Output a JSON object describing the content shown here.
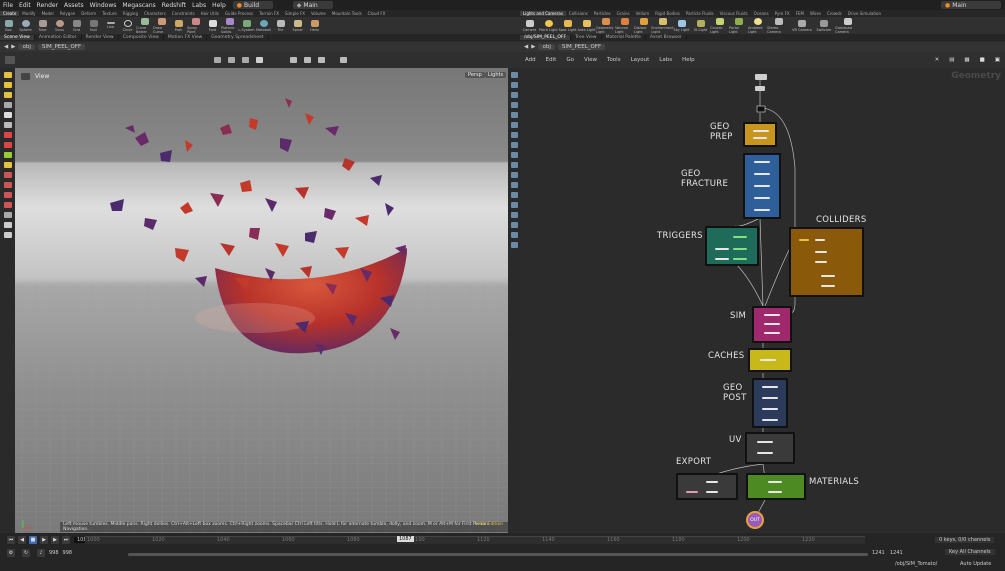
{
  "menu": [
    "File",
    "Edit",
    "Render",
    "Assets",
    "Windows",
    "Megascans",
    "Redshift",
    "Labs",
    "Help"
  ],
  "desktop": "Build",
  "take": "Main",
  "network_dropdown": "Main",
  "shelf_tabs": [
    "Create",
    "Modify",
    "Model",
    "Polygon",
    "Deform",
    "Texture",
    "Rigging",
    "Characters",
    "Constraints",
    "Hair Utils",
    "Guide Process",
    "Terrain FX",
    "Simple FX",
    "Volume",
    "Mountain Tools",
    "Cloud FX",
    "Lights and Cameras",
    "Collisions",
    "Particles",
    "Grains",
    "Vellum",
    "Rigid Bodies",
    "Particle Fluids",
    "Viscous Fluids",
    "Oceans",
    "Pyro FX",
    "FEM",
    "Wires",
    "Crowds",
    "Drive Simulation"
  ],
  "tools_left": [
    "Box",
    "Sphere",
    "Tube",
    "Torus",
    "Grid",
    "Null",
    "Line",
    "Circle",
    "Curve Bezier",
    "Draw Curve",
    "Path",
    "Spray Paint",
    "Font",
    "Platonic Solids",
    "L-System",
    "Metaball",
    "File",
    "Spiral",
    "Helix"
  ],
  "tools_right": [
    "Camera",
    "Point Light",
    "Spot Light",
    "Area Light",
    "Geometry Light",
    "Volume Light",
    "Distant Light",
    "Environment Light",
    "Sky Light",
    "GI Light",
    "Caustic Light",
    "Portal Light",
    "Ambient Light",
    "Stereo Camera",
    "VR Camera",
    "Switcher",
    "Gamepad Camera"
  ],
  "pane_tabs_left": [
    "Scene View",
    "Animation Editor",
    "Render View",
    "Composite View",
    "Motion FX View",
    "Geometry Spreadsheet"
  ],
  "pane_tabs_right": [
    "/obj/SIM_PEEL_OFF",
    "Tree View",
    "Material Palette",
    "Asset Browser"
  ],
  "path_left": {
    "ctx": "obj",
    "node": "SIM_PEEL_OFF"
  },
  "path_right": {
    "ctx": "obj",
    "node": "SIM_PEEL_OFF"
  },
  "viewport": {
    "label": "View",
    "persp": "Persp",
    "cam": "Lights",
    "help_text": "Left mouse tumbles. Middle pans. Right dollies. Ctrl+Alt+Left box zooms. Ctrl+Right zooms. Spacebar Ctrl Left tilts. Hold L for alternate tumble, dolly, and zoom. M or Alt+M for First Person Navigation.",
    "edition": "Indie Edition"
  },
  "net_menu": [
    "Add",
    "Edit",
    "Go",
    "View",
    "Tools",
    "Layout",
    "Labs",
    "Help"
  ],
  "net_context": "Geometry",
  "net_labels": {
    "geo_prep": "GEO\nPREP",
    "geo_fracture": "GEO\nFRACTURE",
    "triggers": "TRIGGERS",
    "colliders": "COLLIDERS",
    "sim": "SIM",
    "caches": "CACHES",
    "geo_post": "GEO\nPOST",
    "uv": "UV",
    "export": "EXPORT",
    "materials": "MATERIALS",
    "out_node": "OUT"
  },
  "colors": {
    "geo_prep": "#c8961e",
    "geo_fracture": "#2f5f9a",
    "triggers": "#1f6b5a",
    "colliders": "#8a5a0a",
    "sim": "#a0296e",
    "caches": "#c8b81a",
    "geo_post": "#2c3a5c",
    "uv": "#3a3a3a",
    "export": "#3a3a3a",
    "materials": "#4e8a22",
    "out": "#9a5ab8"
  },
  "timeline": {
    "current_frame": "1087",
    "start": "998",
    "start2": "998",
    "end": "1241",
    "end2": "1241",
    "ticks": [
      "1000",
      "1020",
      "1040",
      "1060",
      "1080",
      "1100",
      "1120",
      "1140",
      "1160",
      "1180",
      "1200",
      "1220"
    ],
    "keys_info": "0 keys, 0/0 channels",
    "key_all": "Key All Channels",
    "status_path": "/obj/SIM_Tomato/",
    "auto_update": "Auto Update"
  }
}
